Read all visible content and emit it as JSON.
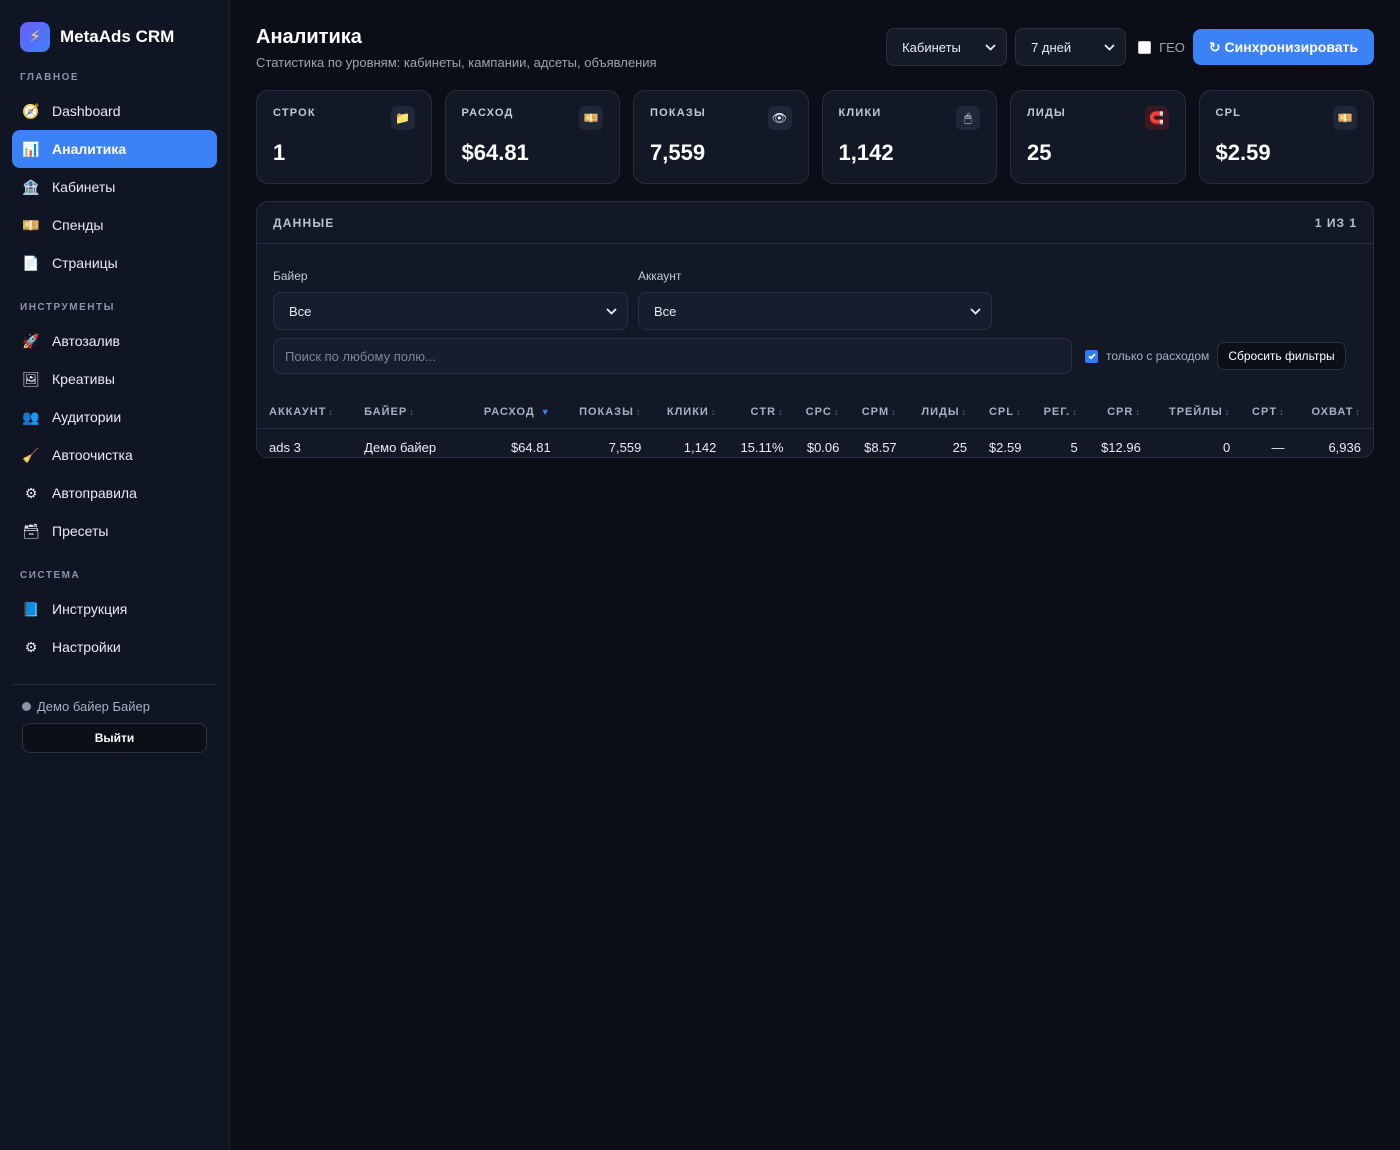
{
  "brand": {
    "name": "MetaAds CRM",
    "logo_icon": "lightning-icon"
  },
  "sidebar": {
    "sections": [
      {
        "title": "ГЛАВНОЕ"
      },
      {
        "title": "ИНСТРУМЕНТЫ"
      },
      {
        "title": "СИСТЕМА"
      }
    ],
    "items": [
      {
        "label": "Dashboard",
        "icon": "📊"
      },
      {
        "label": "Аналитика",
        "icon": "📊"
      },
      {
        "label": "Кабинеты",
        "icon": "🏦"
      },
      {
        "label": "Спенды",
        "icon": "💴"
      },
      {
        "label": "Страницы",
        "icon": "📄"
      },
      {
        "label": "Автозалив",
        "icon": "🚀"
      },
      {
        "label": "Креативы",
        "icon": "🖼"
      },
      {
        "label": "Аудитории",
        "icon": "👥"
      },
      {
        "label": "Автоочистка",
        "icon": "🧹"
      },
      {
        "label": "Автоправила",
        "icon": "⚙"
      },
      {
        "label": "Пресеты",
        "icon": "🗃"
      },
      {
        "label": "Инструкция",
        "icon": "📘"
      },
      {
        "label": "Настройки",
        "icon": "⚙"
      }
    ],
    "active_item": "Аналитика",
    "user": {
      "label": "Демо байер Байер"
    },
    "logout_label": "Выйти"
  },
  "header": {
    "title": "Аналитика",
    "subtitle": "Статистика по уровням: кабинеты, кампании, адсеты, объявления",
    "level_select": "Кабинеты",
    "period_select": "7 дней",
    "geo_label": "ГЕО",
    "geo_checked": false,
    "sync_label": "↻ Синхронизировать"
  },
  "stats": [
    {
      "label": "СТРОК",
      "value": "1",
      "icon": "📁"
    },
    {
      "label": "РАСХОД",
      "value": "$64.81",
      "icon": "💴"
    },
    {
      "label": "ПОКАЗЫ",
      "value": "7,559",
      "icon": "👁"
    },
    {
      "label": "КЛИКИ",
      "value": "1,142",
      "icon": "🖱"
    },
    {
      "label": "ЛИДЫ",
      "value": "25",
      "icon": "🧲"
    },
    {
      "label": "CPL",
      "value": "$2.59",
      "icon": "💴"
    }
  ],
  "panel": {
    "title": "ДАННЫЕ",
    "count": "1 ИЗ 1",
    "filters": {
      "buyer_label": "Байер",
      "buyer_value": "Все",
      "account_label": "Аккаунт",
      "account_value": "Все",
      "search_placeholder": "Поиск по любому полю...",
      "spend_only_label": "только с расходом",
      "spend_only_checked": true,
      "reset_label": "Сбросить фильтры"
    },
    "table": {
      "columns": [
        "АККАУНТ",
        "БАЙЕР",
        "РАСХОД",
        "ПОКАЗЫ",
        "КЛИКИ",
        "CTR",
        "CPC",
        "CPM",
        "ЛИДЫ",
        "CPL",
        "РЕГ.",
        "CPR",
        "ТРЕЙЛЫ",
        "CPT",
        "ОХВАТ"
      ],
      "sorted_column": "РАСХОД",
      "sort_dir": "desc",
      "rows": [
        [
          "ads 3",
          "Демо байер",
          "$64.81",
          "7,559",
          "1,142",
          "15.11%",
          "$0.06",
          "$8.57",
          "25",
          "$2.59",
          "5",
          "$12.96",
          "0",
          "—",
          "6,936"
        ]
      ]
    }
  },
  "colors": {
    "accent": "#3b82f6",
    "background": "#0b0e16",
    "sidebar": "#0f1522",
    "card": "#121826"
  }
}
